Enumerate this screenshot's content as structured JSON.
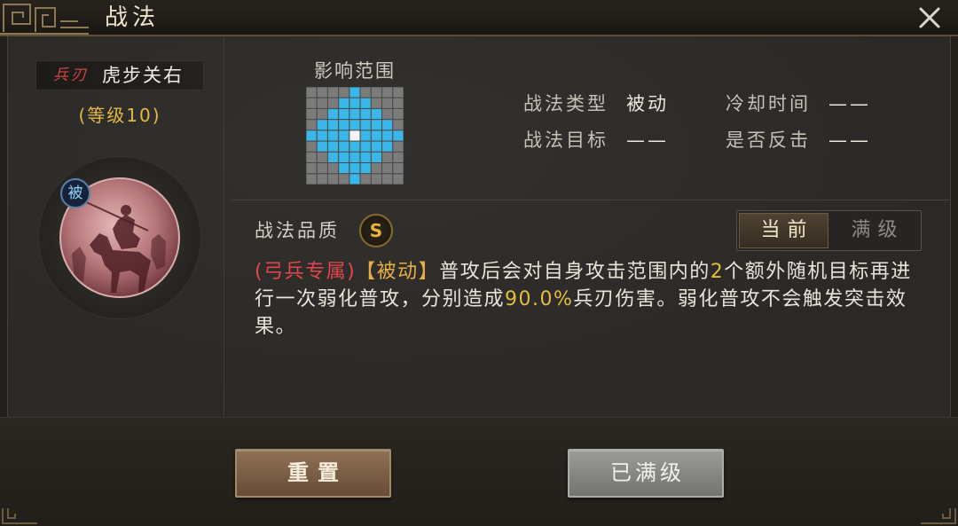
{
  "window": {
    "title": "战法",
    "close_icon": "close-icon"
  },
  "skill": {
    "damage_tag": "兵刃",
    "name": "虎步关右",
    "level": "(等级10)",
    "kind_badge": "被",
    "portrait_icon": "mounted-general-portrait"
  },
  "range": {
    "label": "影响范围",
    "grid": [
      [
        0,
        0,
        0,
        0,
        1,
        0,
        0,
        0,
        0
      ],
      [
        0,
        0,
        0,
        1,
        1,
        1,
        0,
        0,
        0
      ],
      [
        0,
        0,
        1,
        1,
        1,
        1,
        1,
        0,
        0
      ],
      [
        0,
        1,
        1,
        1,
        1,
        1,
        1,
        1,
        0
      ],
      [
        1,
        1,
        1,
        1,
        2,
        1,
        1,
        1,
        1
      ],
      [
        0,
        1,
        1,
        1,
        1,
        1,
        1,
        1,
        0
      ],
      [
        0,
        0,
        1,
        1,
        1,
        1,
        1,
        0,
        0
      ],
      [
        0,
        0,
        0,
        1,
        1,
        1,
        0,
        0,
        0
      ],
      [
        0,
        0,
        0,
        0,
        1,
        0,
        0,
        0,
        0
      ]
    ],
    "colors": {
      "empty": "#7b7b7b",
      "in_range": "#3bb6e8",
      "self": "#f4f4f4"
    }
  },
  "attributes": [
    {
      "label": "战法类型",
      "value": "被动"
    },
    {
      "label": "冷却时间",
      "value": "——"
    },
    {
      "label": "战法目标",
      "value": "——"
    },
    {
      "label": "是否反击",
      "value": "——"
    }
  ],
  "quality": {
    "label": "战法品质",
    "grade": "S"
  },
  "level_tabs": [
    {
      "label": "当前",
      "selected": true
    },
    {
      "label": "满级",
      "selected": false
    }
  ],
  "description": {
    "segments": [
      {
        "text": "(弓兵专属)",
        "color": "#e2464c"
      },
      {
        "text": "【被动】",
        "color": "#e8ae46"
      },
      {
        "text": "普攻后会对自身攻击范围内的",
        "color": "#e8e4da"
      },
      {
        "text": "2",
        "color": "#e3bd3b"
      },
      {
        "text": "个额外随机目标再进行一次弱化普攻，分别造成",
        "color": "#e8e4da"
      },
      {
        "text": "90.0%",
        "color": "#e3bd3b"
      },
      {
        "text": "兵刃伤害。弱化普攻不会触发突击效果。",
        "color": "#e8e4da"
      }
    ]
  },
  "buttons": {
    "reset": "重置",
    "maxed": "已满级"
  }
}
